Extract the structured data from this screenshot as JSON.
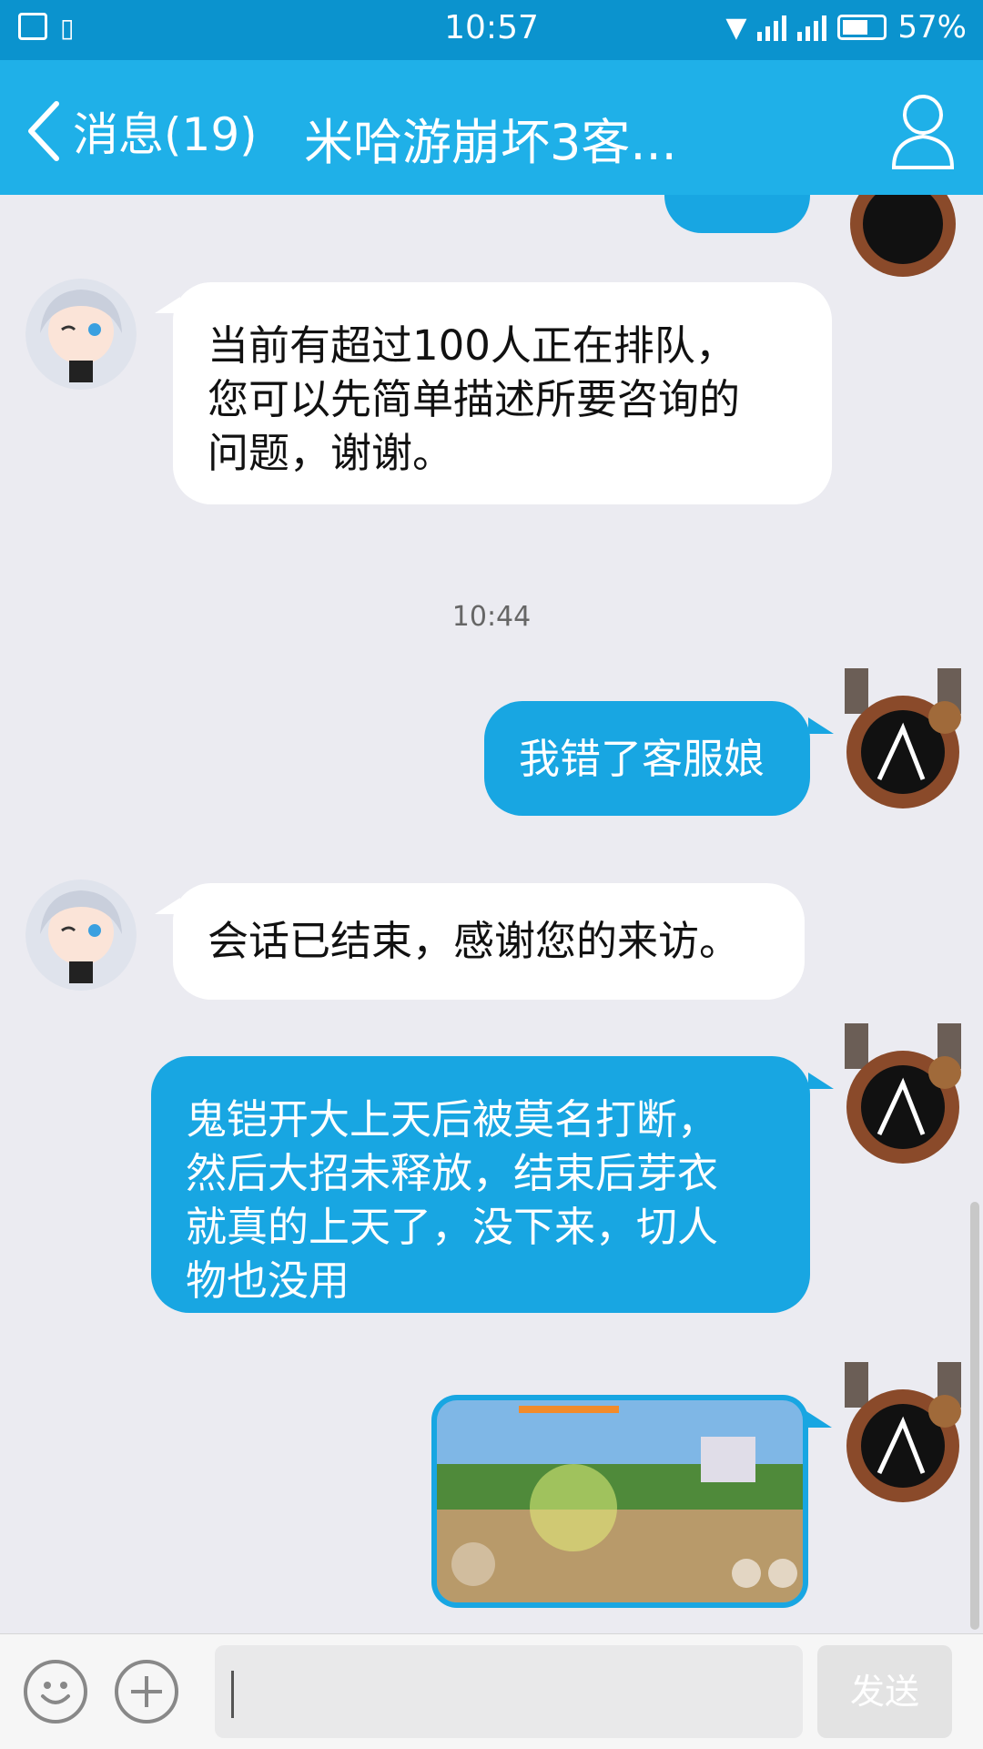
{
  "status_bar": {
    "time": "10:57",
    "battery": "57%"
  },
  "nav": {
    "back_label": "消息(19)",
    "title": "米哈游崩坏3客..."
  },
  "messages": [
    {
      "text": "当前有超过100人正在排队，\n您可以先简单描述所要咨询的\n问题，谢谢。"
    },
    {
      "timestamp": "10:44"
    },
    {
      "text": "我错了客服娘"
    },
    {
      "text": "会话已结束，感谢您的来访。"
    },
    {
      "text": "鬼铠开大上天后被莫名打断，\n然后大招未释放，结束后芽衣\n就真的上天了，没下来，切人\n物也没用"
    }
  ],
  "input": {
    "placeholder": "",
    "send_label": "发送"
  },
  "colors": {
    "nav": "#1fb0e8",
    "status": "#0b93ce",
    "bubble_out": "#18a6e2",
    "bubble_in": "#ffffff"
  }
}
